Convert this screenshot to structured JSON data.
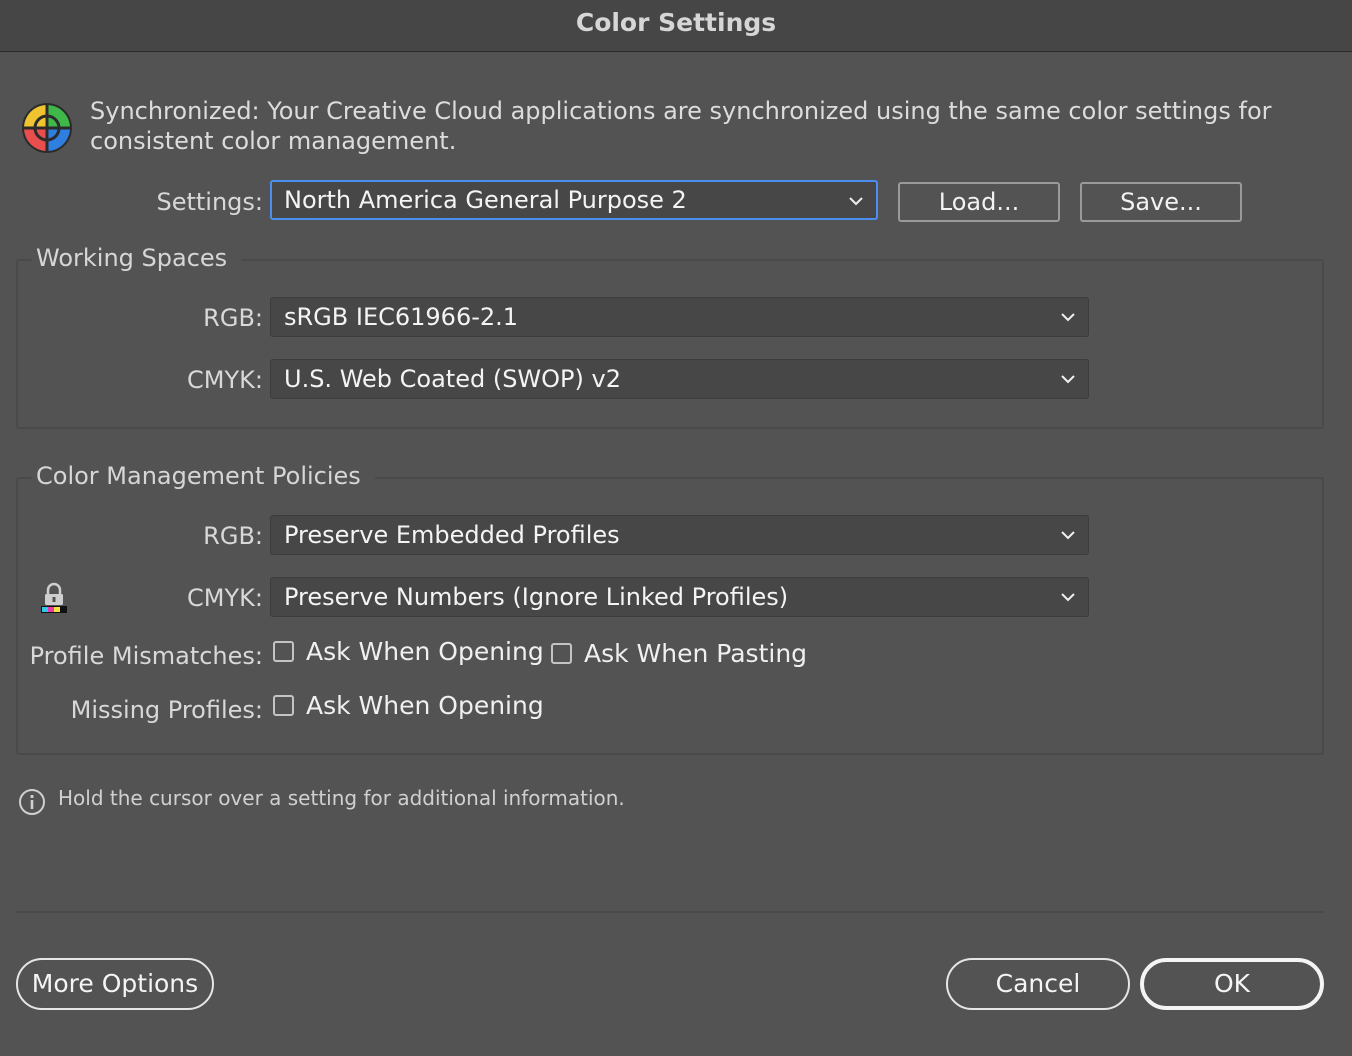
{
  "window": {
    "title": "Color Settings"
  },
  "sync": {
    "icon": "color-wheel-icon",
    "message": "Synchronized: Your Creative Cloud applications are synchronized using the same color settings for consistent color management."
  },
  "settings": {
    "label": "Settings:",
    "value": "North America General Purpose 2",
    "load_label": "Load...",
    "save_label": "Save..."
  },
  "working_spaces": {
    "title": "Working Spaces",
    "rgb_label": "RGB:",
    "rgb_value": "sRGB IEC61966-2.1",
    "cmyk_label": "CMYK:",
    "cmyk_value": "U.S. Web Coated (SWOP) v2"
  },
  "policies": {
    "title": "Color Management Policies",
    "rgb_label": "RGB:",
    "rgb_value": "Preserve Embedded Profiles",
    "cmyk_label": "CMYK:",
    "cmyk_value": "Preserve Numbers (Ignore Linked Profiles)",
    "cmyk_lock_icon": "lock-icon",
    "mismatch_label": "Profile Mismatches:",
    "mismatch_opening_label": "Ask When Opening",
    "mismatch_opening_checked": false,
    "mismatch_pasting_label": "Ask When Pasting",
    "mismatch_pasting_checked": false,
    "missing_label": "Missing Profiles:",
    "missing_opening_label": "Ask When Opening",
    "missing_opening_checked": false
  },
  "info": {
    "icon": "info-icon",
    "text": "Hold the cursor over a setting for additional information."
  },
  "footer": {
    "more_options_label": "More Options",
    "cancel_label": "Cancel",
    "ok_label": "OK"
  },
  "colors": {
    "background": "#535353",
    "focus_ring": "#4a8ef0",
    "field": "#474747"
  }
}
